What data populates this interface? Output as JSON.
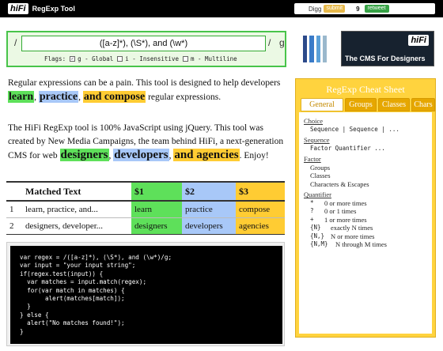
{
  "topbar": {
    "logo_text": "hiFi",
    "tool_name": "RegExp Tool",
    "digg_label": "Digg",
    "digg_submit": "submit",
    "digg_count": "9",
    "retweet_label": "retweet"
  },
  "regex": {
    "slash_open": "/",
    "value": "([a-z]*), (\\S*), and (\\w*)",
    "slash_close": "/",
    "flag_suffix": "g",
    "flags_label": "Flags:",
    "flags": [
      {
        "label": "g - Global",
        "checked": true
      },
      {
        "label": "i - Insensitive",
        "checked": false
      },
      {
        "label": "m - Multiline",
        "checked": false
      }
    ]
  },
  "banner": {
    "logo_text": "hiFi",
    "text": "The CMS For Designers",
    "stripe_colors": [
      "#2c4a8a",
      "#3a7bc8",
      "#5ba0d8",
      "#9ab8cc"
    ]
  },
  "intro1": {
    "before": "Regular expressions can be a pain. This tool is designed to help developers ",
    "w1": "learn",
    "w2": "practice",
    "w3": "and compose",
    "after": " regular expressions."
  },
  "intro2": {
    "before": "The HiFi RegExp tool is 100% JavaScript using jQuery. This tool was created by New Media Campaigns, the team behind HiFi, a next-generation CMS for web ",
    "w1": "designers",
    "w2": "developers",
    "w3": "and agencies",
    "after": ". Enjoy!"
  },
  "table": {
    "headers": [
      "",
      "Matched Text",
      "$1",
      "$2",
      "$3"
    ],
    "rows": [
      [
        "1",
        "learn, practice, and...",
        "learn",
        "practice",
        "compose"
      ],
      [
        "2",
        "designers, developer...",
        "designers",
        "developers",
        "agencies"
      ]
    ]
  },
  "code": "var regex = /([a-z]*), (\\S*), and (\\w*)/g;\nvar input = \"your input string\";\nif(regex.test(input)) {\n  var matches = input.match(regex);\n  for(var match in matches) {\n       alert(matches[match]);\n  }\n} else {\n  alert(\"No matches found!\");\n}",
  "cheat": {
    "title": "RegExp Cheat Sheet",
    "tabs": [
      "General",
      "Groups",
      "Classes",
      "Chars"
    ],
    "choice_title": "Choice",
    "choice_body": "Sequence | Sequence | ...",
    "sequence_title": "Sequence",
    "sequence_body": "Factor Quantifier ...",
    "factor_title": "Factor",
    "factor_items": [
      "Groups",
      "Classes",
      "Characters & Escapes"
    ],
    "quantifier_title": "Quantifier",
    "quantifiers": [
      {
        "sym": "*",
        "desc": "0 or more times"
      },
      {
        "sym": "?",
        "desc": "0 or 1 times"
      },
      {
        "sym": "+",
        "desc": "1 or more times"
      },
      {
        "sym": "{N}",
        "desc": "exactly N times"
      },
      {
        "sym": "{N,}",
        "desc": "N or more times"
      },
      {
        "sym": "{N,M}",
        "desc": "N through M times"
      }
    ]
  }
}
